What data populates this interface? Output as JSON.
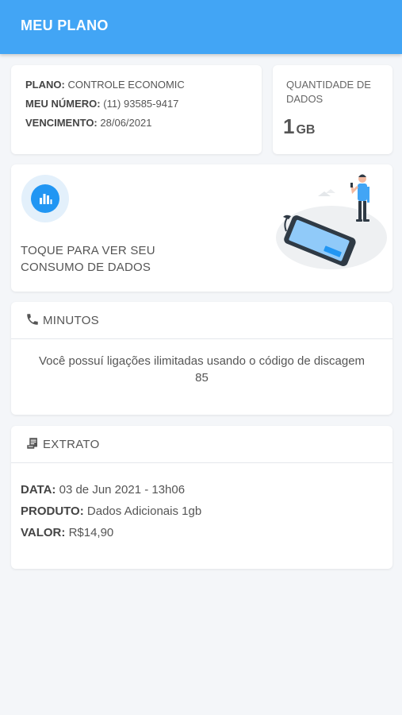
{
  "header": {
    "title": "MEU PLANO"
  },
  "plan": {
    "plano_label": "PLANO:",
    "plano_value": "CONTROLE ECONOMIC",
    "numero_label": "MEU NÚMERO:",
    "numero_value": "(11) 93585-9417",
    "vencimento_label": "VENCIMENTO:",
    "vencimento_value": "28/06/2021"
  },
  "data": {
    "label": "QUANTIDADE DE DADOS",
    "amount": "1",
    "unit": "GB"
  },
  "consumo": {
    "text": "TOQUE PARA VER SEU CONSUMO DE DADOS",
    "icon": "bar-chart-icon"
  },
  "minutos": {
    "title": "MINUTOS",
    "icon": "phone-icon",
    "text": "Você possuí ligações ilimitadas usando o código de discagem 85"
  },
  "extrato": {
    "title": "EXTRATO",
    "icon": "receipt-icon",
    "data_label": "DATA:",
    "data_value": "03 de Jun 2021 - 13h06",
    "produto_label": "PRODUTO:",
    "produto_value": "Dados Adicionais 1gb",
    "valor_label": "VALOR:",
    "valor_value": "R$14,90"
  },
  "colors": {
    "accent": "#42a5f5",
    "icon_blue": "#2196f3",
    "background": "#f4f6f9"
  }
}
